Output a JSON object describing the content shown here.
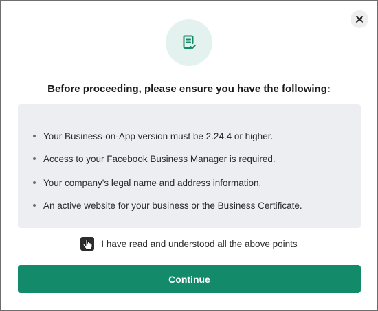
{
  "dialog": {
    "heading": "Before proceeding, please ensure you have the following:",
    "header_icon": "checklist-icon",
    "close_icon": "close-icon"
  },
  "requirements": [
    "Your Business-on-App version must be 2.24.4 or higher.",
    "Access to your Facebook Business Manager is required.",
    "Your company's legal name and address information.",
    "An active website for your business or the Business Certificate."
  ],
  "agreement": {
    "label": "I have read and understood all the above points",
    "checkbox_icon": "hand-cursor-icon",
    "checked": false
  },
  "actions": {
    "continue_label": "Continue"
  },
  "colors": {
    "accent": "#138a69",
    "icon_circle_bg": "#e4f2ef",
    "requirements_bg": "#eceef2"
  }
}
